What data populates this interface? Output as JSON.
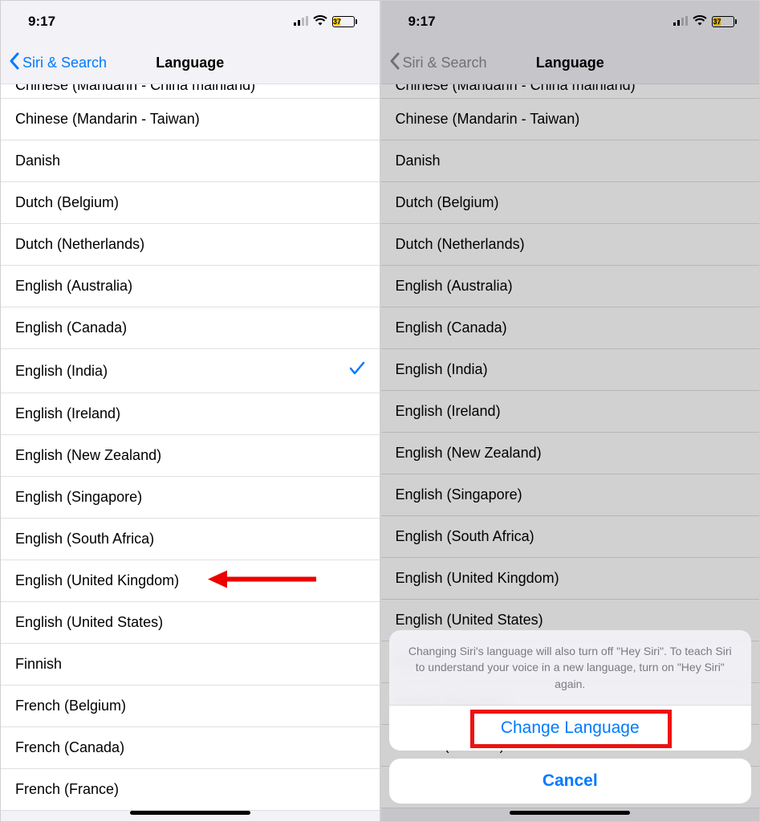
{
  "status": {
    "time": "9:17",
    "battery": "37"
  },
  "nav": {
    "back": "Siri & Search",
    "title": "Language"
  },
  "left": {
    "items": [
      {
        "label": "Chinese (Mandarin - China mainland)",
        "cut": true
      },
      {
        "label": "Chinese (Mandarin - Taiwan)"
      },
      {
        "label": "Danish"
      },
      {
        "label": "Dutch (Belgium)"
      },
      {
        "label": "Dutch (Netherlands)"
      },
      {
        "label": "English (Australia)"
      },
      {
        "label": "English (Canada)"
      },
      {
        "label": "English (India)",
        "selected": true
      },
      {
        "label": "English (Ireland)"
      },
      {
        "label": "English (New Zealand)"
      },
      {
        "label": "English (Singapore)"
      },
      {
        "label": "English (South Africa)"
      },
      {
        "label": "English (United Kingdom)",
        "arrow": true
      },
      {
        "label": "English (United States)"
      },
      {
        "label": "Finnish"
      },
      {
        "label": "French (Belgium)"
      },
      {
        "label": "French (Canada)"
      },
      {
        "label": "French (France)"
      }
    ]
  },
  "right": {
    "items": [
      {
        "label": "Chinese (Mandarin - China mainland)",
        "cut": true
      },
      {
        "label": "Chinese (Mandarin - Taiwan)"
      },
      {
        "label": "Danish"
      },
      {
        "label": "Dutch (Belgium)"
      },
      {
        "label": "Dutch (Netherlands)"
      },
      {
        "label": "English (Australia)"
      },
      {
        "label": "English (Canada)"
      },
      {
        "label": "English (India)"
      },
      {
        "label": "English (Ireland)"
      },
      {
        "label": "English (New Zealand)"
      },
      {
        "label": "English (Singapore)"
      },
      {
        "label": "English (South Africa)"
      },
      {
        "label": "English (United Kingdom)"
      },
      {
        "label": "English (United States)"
      },
      {
        "label": "Finnish"
      },
      {
        "label": "French (Belgium)"
      },
      {
        "label": "French (Canada)"
      },
      {
        "label": "French (France)"
      }
    ]
  },
  "sheet": {
    "message": "Changing Siri's language will also turn off \"Hey Siri\". To teach Siri to understand your voice in a new language, turn on \"Hey Siri\" again.",
    "action": "Change Language",
    "cancel": "Cancel"
  }
}
